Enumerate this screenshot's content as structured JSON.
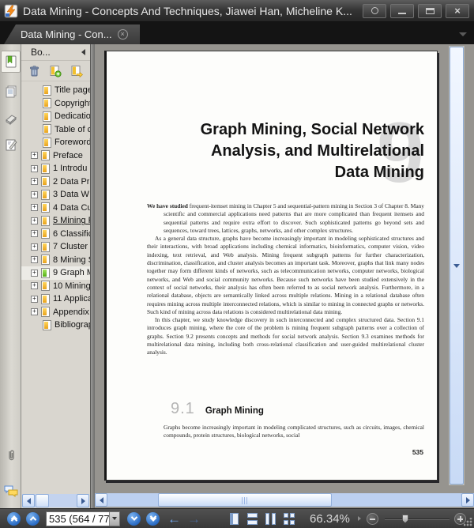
{
  "window": {
    "title": "Data Mining - Concepts And Techniques, Jiawei Han, Micheline K...",
    "close_glyph": "×"
  },
  "tabbar": {
    "active_tab_label": "Data Mining - Con...",
    "tab_close_glyph": "×"
  },
  "sidebar": {
    "header_label": "Bo...",
    "plus_glyph": "+",
    "tree": [
      {
        "label": "Title page",
        "plus": false,
        "color": "y"
      },
      {
        "label": "Copyright",
        "plus": false,
        "color": "y"
      },
      {
        "label": "Dedication",
        "plus": false,
        "color": "y"
      },
      {
        "label": "Table of c",
        "plus": false,
        "color": "y"
      },
      {
        "label": "Foreword",
        "plus": false,
        "color": "y"
      },
      {
        "label": "Preface",
        "plus": true,
        "color": "y"
      },
      {
        "label": "1 Introdu",
        "plus": true,
        "color": "y"
      },
      {
        "label": "2 Data Pr",
        "plus": true,
        "color": "y"
      },
      {
        "label": "3 Data W",
        "plus": true,
        "color": "y"
      },
      {
        "label": "4 Data Cu",
        "plus": true,
        "color": "y"
      },
      {
        "label": "5 Mining F",
        "plus": true,
        "color": "y",
        "underline": true
      },
      {
        "label": "6 Classific",
        "plus": true,
        "color": "y"
      },
      {
        "label": "7 Cluster",
        "plus": true,
        "color": "y"
      },
      {
        "label": "8 Mining S",
        "plus": true,
        "color": "y"
      },
      {
        "label": "9 Graph M",
        "plus": true,
        "color": "g",
        "selected": true
      },
      {
        "label": "10 Mining",
        "plus": true,
        "color": "y"
      },
      {
        "label": "11 Applica",
        "plus": true,
        "color": "y"
      },
      {
        "label": "Appendix",
        "plus": true,
        "color": "y"
      },
      {
        "label": "Bibliograp",
        "plus": false,
        "color": "y"
      }
    ]
  },
  "page": {
    "watermark_number": "9",
    "chapter_title": "Graph Mining, Social Network\nAnalysis, and Multirelational\nData Mining",
    "para1_lead": "We have studied",
    "para1_rest": " frequent-itemset mining in Chapter 5 and sequential-pattern mining in Section 3 of Chapter 8. Many scientific and commercial applications need patterns that are more complicated than frequent itemsets and sequential patterns and require extra effort to discover. Such sophisticated patterns go beyond sets and sequences, toward trees, lattices, graphs, networks, and other complex structures.",
    "para2": "As a general data structure, graphs have become increasingly important in modeling sophisticated structures and their interactions, with broad applications including chemical informatics, bioinformatics, computer vision, video indexing, text retrieval, and Web analysis. Mining frequent subgraph patterns for further characterization, discrimination, classification, and cluster analysis becomes an important task. Moreover, graphs that link many nodes together may form different kinds of networks, such as telecommunication networks, computer networks, biological networks, and Web and social community networks. Because such networks have been studied extensively in the context of social networks, their analysis has often been referred to as social network analysis. Furthermore, in a relational database, objects are semantically linked across multiple relations. Mining in a relational database often requires mining across multiple interconnected relations, which is similar to mining in connected graphs or networks. Such kind of mining across data relations is considered multirelational data mining.",
    "para3": "In this chapter, we study knowledge discovery in such interconnected and complex structured data. Section 9.1 introduces graph mining, where the core of the problem is mining frequent subgraph patterns over a collection of graphs. Section 9.2 presents concepts and methods for social network analysis. Section 9.3 examines methods for multirelational data mining, including both cross-relational classification and user-guided multirelational cluster analysis.",
    "section_number": "9.1",
    "section_title": "Graph Mining",
    "section_body": "Graphs become increasingly important in modeling complicated structures, such as circuits, images, chemical compounds, protein structures, biological networks, social",
    "page_number": "535"
  },
  "statusbar": {
    "page_field_value": "535 (564 / 77",
    "zoom_percent": "66.34%"
  }
}
